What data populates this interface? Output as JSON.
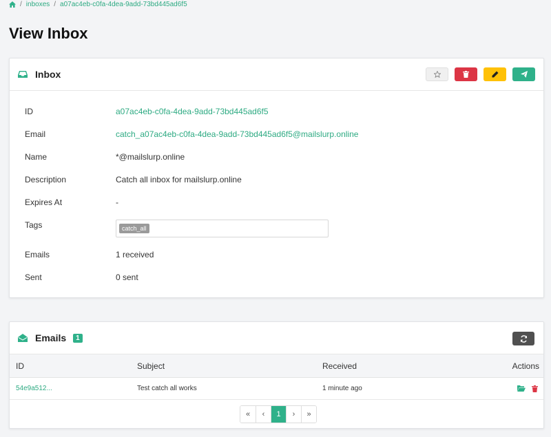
{
  "breadcrumb": {
    "home_icon": "home-icon",
    "items": [
      "inboxes",
      "a07ac4eb-c0fa-4dea-9add-73bd445ad6f5"
    ]
  },
  "page_title": "View Inbox",
  "inbox_card": {
    "title": "Inbox",
    "icon": "inbox-icon",
    "buttons": [
      "star-icon",
      "trash-icon",
      "pencil-icon",
      "paper-plane-icon"
    ],
    "fields": [
      {
        "label": "ID",
        "value": "a07ac4eb-c0fa-4dea-9add-73bd445ad6f5"
      },
      {
        "label": "Email",
        "value": "catch_a07ac4eb-c0fa-4dea-9add-73bd445ad6f5@mailslurp.online"
      },
      {
        "label": "Name",
        "value": "*@mailslurp.online"
      },
      {
        "label": "Description",
        "value": "Catch all inbox for mailslurp.online"
      },
      {
        "label": "Expires At",
        "value": "-"
      },
      {
        "label": "Tags",
        "value": "catch_all"
      },
      {
        "label": "Emails",
        "value": "1 received"
      },
      {
        "label": "Sent",
        "value": "0 sent"
      }
    ]
  },
  "emails_card": {
    "title": "Emails",
    "count": "1",
    "icon": "envelope-open-icon",
    "columns": [
      "ID",
      "Subject",
      "Received",
      "Actions"
    ],
    "rows": [
      {
        "id": "54e9a512...",
        "subject": "Test catch all works",
        "received": "1 minute ago"
      }
    ],
    "pager": [
      "«",
      "‹",
      "1",
      "›",
      "»"
    ]
  },
  "colors": {
    "accent": "#2fb18a",
    "danger": "#dc3545",
    "warning": "#ffc107",
    "dark": "#505050"
  }
}
